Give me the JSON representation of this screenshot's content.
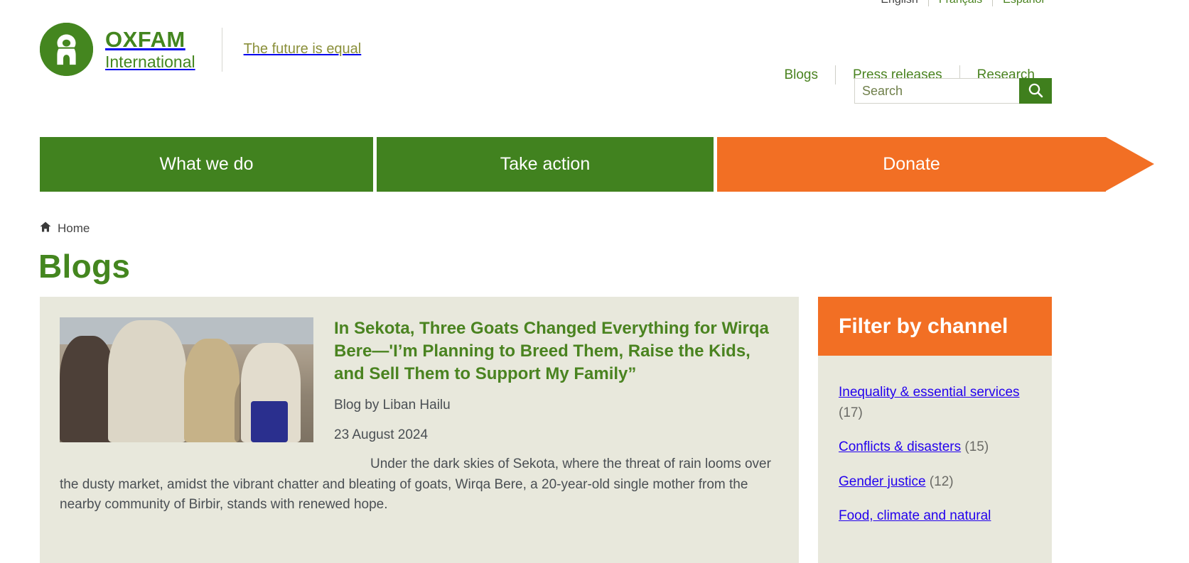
{
  "language_bar": {
    "links": [
      {
        "label": "English",
        "active": true
      },
      {
        "label": "Français",
        "active": false
      },
      {
        "label": "Español",
        "active": false
      }
    ]
  },
  "header": {
    "logo": {
      "name": "OXFAM",
      "subtitle": "International",
      "icon": "oxfam-person-logo"
    },
    "tagline": "The future is equal",
    "util_nav": [
      {
        "label": "Blogs"
      },
      {
        "label": "Press releases"
      },
      {
        "label": "Research"
      }
    ],
    "search": {
      "placeholder": "Search",
      "value": "",
      "button_icon": "search-icon"
    }
  },
  "main_nav": [
    {
      "label": "What we do",
      "color": "#41821f",
      "style": "green"
    },
    {
      "label": "Take action",
      "color": "#41821f",
      "style": "green"
    },
    {
      "label": "Donate",
      "color": "#f26f24",
      "style": "orange-arrow"
    }
  ],
  "breadcrumb": {
    "icon": "home-icon",
    "items": [
      {
        "label": "Home"
      }
    ]
  },
  "page": {
    "title": "Blogs"
  },
  "articles": [
    {
      "thumbnail_alt": "People standing in a dusty market in Sekota, Ethiopia",
      "title": "In Sekota, Three Goats Changed Everything for Wirqa Bere—'I’m Planning to Breed Them, Raise the Kids, and Sell Them to Support My Family”",
      "byline": "Blog by Liban Hailu",
      "date": "23 August 2024",
      "summary": "Under the dark skies of Sekota, where the threat of rain looms over the dusty market, amidst the vibrant chatter and bleating of goats, Wirqa Bere, a 20-year-old single mother from the nearby community of Birbir, stands with renewed hope."
    }
  ],
  "sidebar": {
    "filter": {
      "title": "Filter by channel",
      "items": [
        {
          "label": "Inequality & essential services",
          "count": "(17)"
        },
        {
          "label": "Conflicts & disasters",
          "count": "(15)"
        },
        {
          "label": "Gender justice",
          "count": "(12)"
        },
        {
          "label": "Food, climate and natural",
          "count": ""
        }
      ]
    }
  },
  "colors": {
    "brand_green": "#44861f",
    "nav_green": "#41821f",
    "accent_orange": "#f26f24",
    "card_beige": "#e8e8dc",
    "link_blue": "#2200ee"
  }
}
